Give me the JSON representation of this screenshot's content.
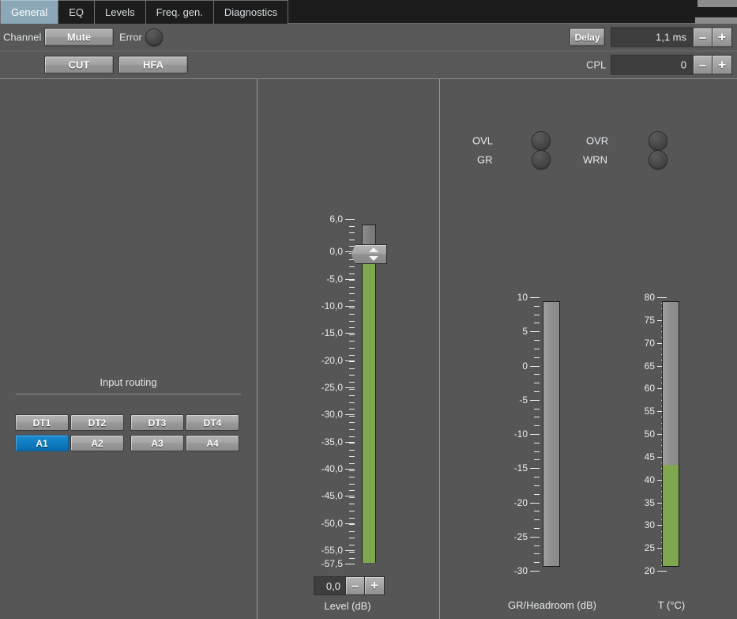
{
  "tabs": [
    {
      "label": "General",
      "active": true
    },
    {
      "label": "EQ",
      "active": false
    },
    {
      "label": "Levels",
      "active": false
    },
    {
      "label": "Freq. gen.",
      "active": false
    },
    {
      "label": "Diagnostics",
      "active": false
    }
  ],
  "header": {
    "channel_label": "Channel",
    "mute_label": "Mute",
    "error_label": "Error",
    "cut_label": "CUT",
    "hfa_label": "HFA",
    "delay_label": "Delay",
    "delay_value": "1,1 ms",
    "cpl_label": "CPL",
    "cpl_value": "0",
    "minus_label": "–",
    "plus_label": "+"
  },
  "routing": {
    "title": "Input routing",
    "buttons": [
      {
        "label": "DT1",
        "selected": false
      },
      {
        "label": "DT2",
        "selected": false
      },
      {
        "label": "DT3",
        "selected": false
      },
      {
        "label": "DT4",
        "selected": false
      },
      {
        "label": "A1",
        "selected": true
      },
      {
        "label": "A2",
        "selected": false
      },
      {
        "label": "A3",
        "selected": false
      },
      {
        "label": "A4",
        "selected": false
      }
    ]
  },
  "fader": {
    "caption": "Level (dB)",
    "value": "0,0",
    "minus_label": "–",
    "plus_label": "+",
    "handle_position_db": 0.0
  },
  "indicators": [
    {
      "label": "OVL",
      "state": "off"
    },
    {
      "label": "GR",
      "state": "off"
    },
    {
      "label": "OVR",
      "state": "off"
    },
    {
      "label": "WRN",
      "state": "off"
    }
  ],
  "colors": {
    "accent_blue": "#0f7cc0",
    "meter_green": "#7fa84e",
    "panel_bg": "#565656",
    "header_bg": "#585858",
    "tab_active": "#8ba8b8"
  },
  "chart_data": [
    {
      "type": "bar",
      "name": "level-fader",
      "title": "Level (dB)",
      "orientation": "vertical",
      "ylabel": "Level (dB)",
      "ylim": [
        -57.5,
        6.0
      ],
      "tick_labels": [
        "6,0",
        "0,0",
        "-5,0",
        "-10,0",
        "-15,0",
        "-20,0",
        "-25,0",
        "-30,0",
        "-35,0",
        "-40,0",
        "-45,0",
        "-50,0",
        "-55,0",
        "-57,5"
      ],
      "tick_values": [
        6.0,
        0.0,
        -5.0,
        -10.0,
        -15.0,
        -20.0,
        -25.0,
        -30.0,
        -35.0,
        -40.0,
        -45.0,
        -50.0,
        -55.0,
        -57.5
      ],
      "value": 0.0,
      "fill_color": "#7fa84e"
    },
    {
      "type": "bar",
      "name": "gr-headroom-meter",
      "title": "GR/Headroom (dB)",
      "orientation": "vertical",
      "ylabel": "GR/Headroom (dB)",
      "ylim": [
        -30,
        10
      ],
      "tick_labels": [
        "10",
        "5",
        "0",
        "-5",
        "-10",
        "-15",
        "-20",
        "-25",
        "-30"
      ],
      "tick_values": [
        10,
        5,
        0,
        -5,
        -10,
        -15,
        -20,
        -25,
        -30
      ],
      "value": -30,
      "fill_color": "#7fa84e"
    },
    {
      "type": "bar",
      "name": "temperature-meter",
      "title": "T (°C)",
      "orientation": "vertical",
      "ylabel": "T (°C)",
      "ylim": [
        20,
        80
      ],
      "tick_labels": [
        "80",
        "75",
        "70",
        "65",
        "60",
        "55",
        "50",
        "45",
        "40",
        "35",
        "30",
        "25",
        "20"
      ],
      "tick_values": [
        80,
        75,
        70,
        65,
        60,
        55,
        50,
        45,
        40,
        35,
        30,
        25,
        20
      ],
      "value": 43,
      "fill_color": "#7fa84e"
    }
  ],
  "meters": {
    "gr_caption": "GR/Headroom (dB)",
    "temp_caption": "T (°C)"
  }
}
